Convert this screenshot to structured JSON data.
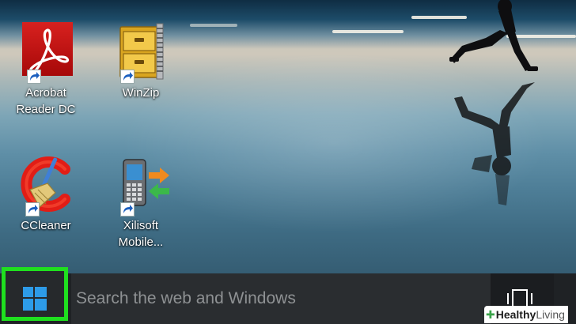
{
  "desktop": {
    "icons": [
      {
        "label_line1": "Acrobat",
        "label_line2": "Reader DC",
        "icon": "adobe-acrobat-icon"
      },
      {
        "label_line1": "WinZip",
        "label_line2": "",
        "icon": "winzip-cabinet-icon"
      },
      {
        "label_line1": "CCleaner",
        "label_line2": "",
        "icon": "ccleaner-icon"
      },
      {
        "label_line1": "Xilisoft",
        "label_line2": "Mobile...",
        "icon": "xilisoft-phone-icon"
      }
    ]
  },
  "taskbar": {
    "search_placeholder": "Search the web and Windows",
    "start_icon": "windows-logo-icon",
    "taskview_icon": "task-view-icon",
    "highlight_color": "#1fe01f"
  },
  "watermark": {
    "brand": "Healthy",
    "brand_suffix": "Living"
  }
}
